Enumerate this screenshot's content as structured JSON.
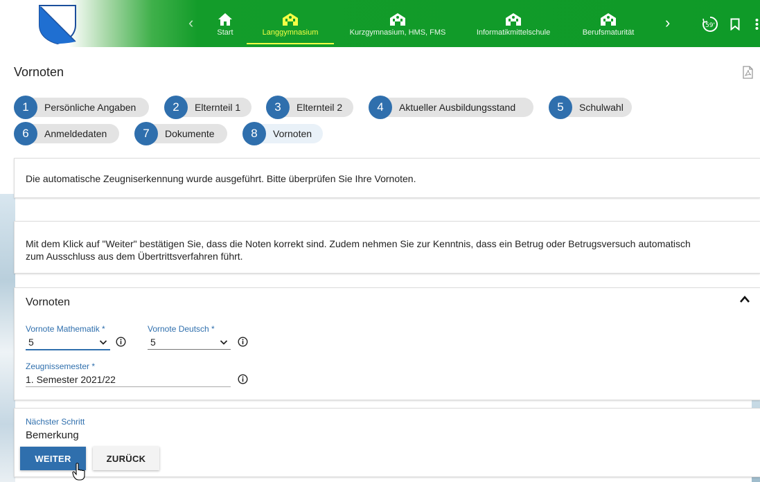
{
  "header": {
    "nav_items": [
      {
        "label": "Start",
        "icon": "home-icon"
      },
      {
        "label": "Langgymnasium",
        "icon": "school-icon",
        "active": true
      },
      {
        "label": "Kurzgymnasium, HMS, FMS",
        "icon": "school-icon"
      },
      {
        "label": "Informatikmittelschule",
        "icon": "school-icon"
      },
      {
        "label": "Berufsmaturität",
        "icon": "school-icon"
      }
    ],
    "timer": "59'",
    "colors": {
      "brand_green": "#129c2a",
      "active_yellow": "#f4ff45"
    }
  },
  "page": {
    "title": "Vornoten"
  },
  "steps": [
    {
      "number": "1",
      "label": "Persönliche Angaben"
    },
    {
      "number": "2",
      "label": "Elternteil 1"
    },
    {
      "number": "3",
      "label": "Elternteil 2"
    },
    {
      "number": "4",
      "label": "Aktueller Ausbildungsstand"
    },
    {
      "number": "5",
      "label": "Schulwahl"
    },
    {
      "number": "6",
      "label": "Anmeldedaten"
    },
    {
      "number": "7",
      "label": "Dokumente"
    },
    {
      "number": "8",
      "label": "Vornoten",
      "current": true
    }
  ],
  "notices": {
    "recognition": "Die automatische Zeugniserkennung wurde ausgeführt. Bitte überprüfen Sie Ihre Vornoten.",
    "confirmation": "Mit dem Klick auf \"Weiter\" bestätigen Sie, dass die Noten korrekt sind. Zudem nehmen Sie zur Kenntnis, dass ein Betrug oder Betrugsversuch automatisch zum Ausschluss aus dem Übertrittsverfahren führt."
  },
  "grades": {
    "section_title": "Vornoten",
    "math": {
      "label": "Vornote Mathematik *",
      "value": "5"
    },
    "german": {
      "label": "Vornote Deutsch *",
      "value": "5"
    },
    "semester": {
      "label": "Zeugnissemester *",
      "value": "1. Semester 2021/22"
    }
  },
  "next_step": {
    "label": "Nächster Schritt",
    "value": "Bemerkung",
    "weiter": "WEITER",
    "zurueck": "ZURÜCK"
  },
  "colors": {
    "primary_blue": "#2f6fad"
  }
}
